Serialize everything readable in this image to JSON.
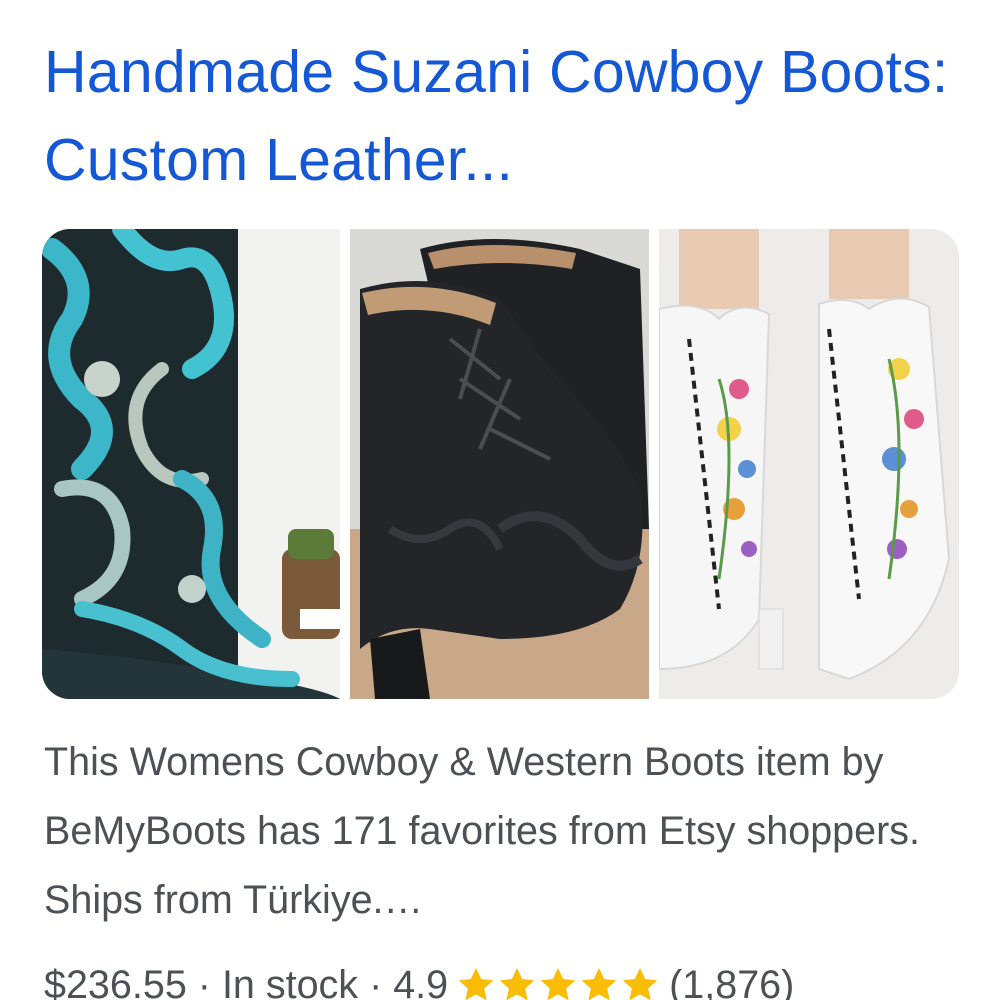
{
  "result": {
    "title": "Handmade Suzani Cowboy Boots: Custom Leather...",
    "snippet": "This Womens Cowboy & Western Boots item by BeMyBoots has 171 favorites from Etsy shoppers. Ships from Türkiye.…",
    "price": "$236.55",
    "separator": "·",
    "stock": "In stock",
    "rating": "4.9",
    "rating_stars": 5,
    "review_count": "(1,876)",
    "star_color": "#fbbc04",
    "title_color": "#1558d6",
    "text_color": "#4d5156"
  },
  "images": [
    {
      "icon": "turquoise-paisley-boot-image"
    },
    {
      "icon": "black-lace-up-bootie-image"
    },
    {
      "icon": "white-embroidered-lace-up-boot-image"
    }
  ]
}
